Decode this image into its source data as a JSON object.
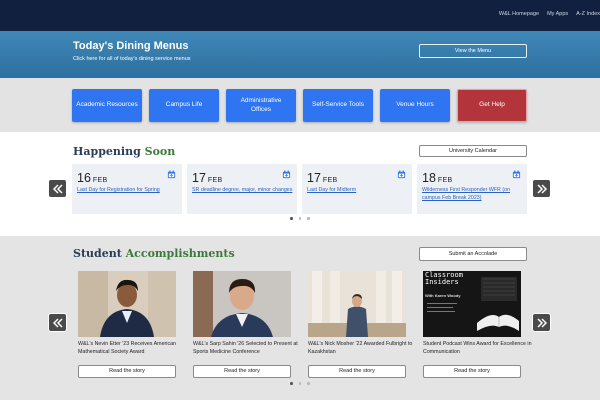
{
  "topnav": {
    "links": [
      "W&L Homepage",
      "My Apps",
      "A-Z Index"
    ]
  },
  "dining": {
    "title": "Today's Dining Menus",
    "subtitle": "Click here for all of today's dining service menus",
    "button": "View the Menu"
  },
  "quick_links": [
    "Academic Resources",
    "Campus Life",
    "Administrative Offices",
    "Self-Service Tools",
    "Venue Hours",
    "Get Help"
  ],
  "happening": {
    "title_part1": "Happening",
    "title_part2": "Soon",
    "button": "University Calendar",
    "events": [
      {
        "day": "16",
        "month": "FEB",
        "title": "Last Day for Registration for Spring"
      },
      {
        "day": "17",
        "month": "FEB",
        "title": "SR deadline degree, major, minor changes"
      },
      {
        "day": "17",
        "month": "FEB",
        "title": "Last Day for Midterm"
      },
      {
        "day": "18",
        "month": "FEB",
        "title": "Wilderness First Responder WFR (on campus Feb Break 2023)"
      }
    ]
  },
  "accomplishments": {
    "title_part1": "Student",
    "title_part2": "Accomplishments",
    "button": "Submit an Accolade",
    "card_button": "Read the story",
    "cards": [
      {
        "caption": "W&L's Nevin Etter '23 Receives American Mathematical Society Award"
      },
      {
        "caption": "W&L's Sarp Sahin '26 Selected to Present at Sports Medicine Conference"
      },
      {
        "caption": "W&L's Nick Mosher '22 Awarded Fulbright to Kazakhstan"
      },
      {
        "caption": "Student Podcast Wins Award for Excellence in Communication"
      }
    ],
    "podcast_image": {
      "line1": "Classroom",
      "line2": "Insiders",
      "host": "With Karen Woody"
    }
  },
  "colors": {
    "navy": "#11203f",
    "dining_blue": "#3a80b0",
    "button_blue": "#2f74f0",
    "help_red": "#b3343a",
    "accent_green": "#3c7a3b"
  }
}
